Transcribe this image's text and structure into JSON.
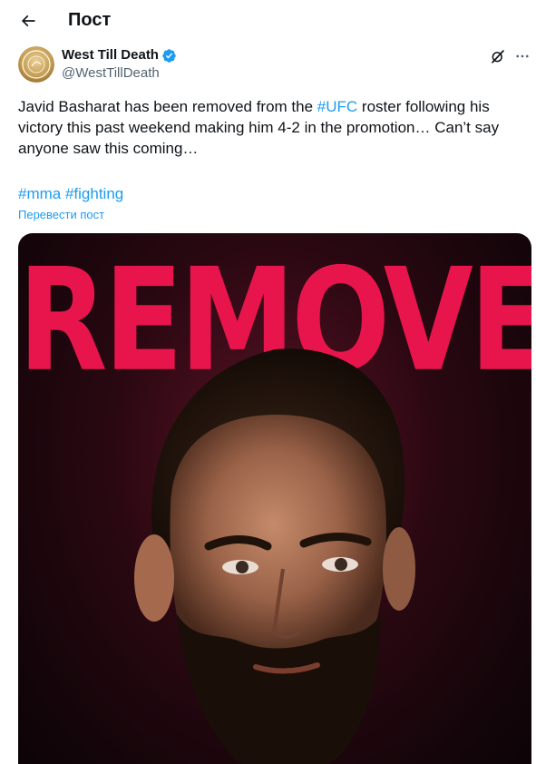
{
  "header": {
    "title": "Пост",
    "back_icon": "arrow-left-icon"
  },
  "tweet": {
    "author": {
      "name": "West Till Death",
      "handle": "@WestTillDeath",
      "verified": true,
      "verified_color": "#1d9bf0",
      "avatar_icon": "west-till-death-logo"
    },
    "text_part1": "Javid Basharat has been removed from the ",
    "text_hashtag": "#UFC",
    "text_part2": " roster following his victory this past weekend making him 4-2 in the promotion… Can’t say anyone saw this coming…",
    "tags": [
      "#mma",
      "#fighting"
    ],
    "translate_label": "Перевести пост",
    "media": {
      "headline": "REMOVED",
      "headline_color": "#e8154d"
    }
  },
  "colors": {
    "accent": "#1d9bf0",
    "text": "#0f1419",
    "muted": "#536471"
  }
}
